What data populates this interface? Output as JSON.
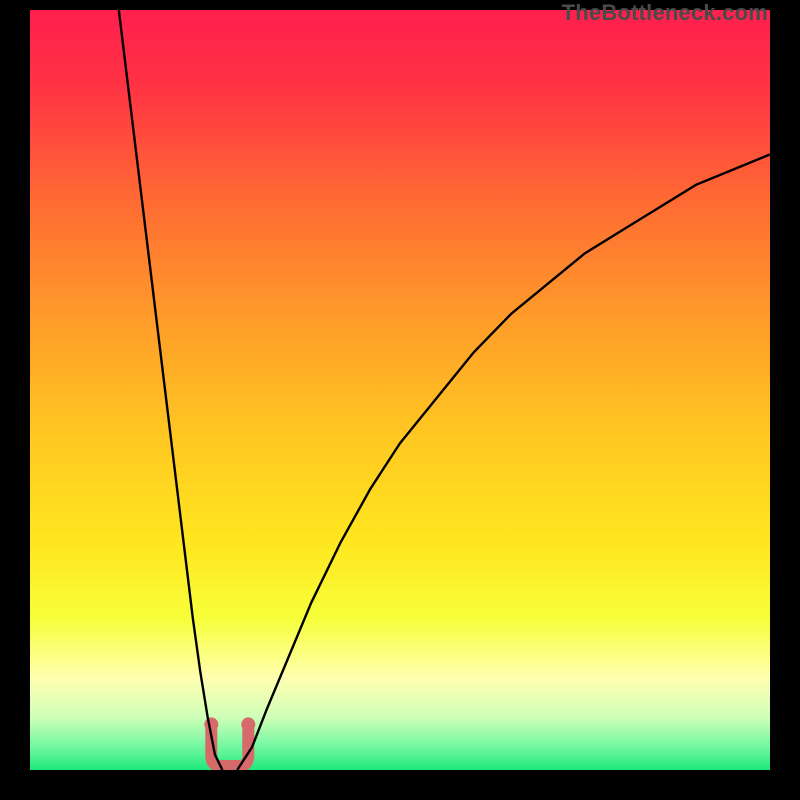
{
  "watermark": "TheBottleneck.com",
  "chart_data": {
    "type": "line",
    "title": "",
    "xlabel": "",
    "ylabel": "",
    "xlim": [
      0,
      100
    ],
    "ylim": [
      0,
      100
    ],
    "grid": false,
    "series": [
      {
        "name": "left-curve",
        "x": [
          12,
          13,
          14,
          15,
          16,
          17,
          18,
          19,
          20,
          21,
          22,
          23,
          24,
          25,
          26
        ],
        "y": [
          100,
          92,
          84,
          76,
          68,
          60,
          52,
          44,
          36,
          28,
          20,
          13,
          7,
          2,
          0
        ]
      },
      {
        "name": "right-curve",
        "x": [
          28,
          30,
          32,
          35,
          38,
          42,
          46,
          50,
          55,
          60,
          65,
          70,
          75,
          80,
          85,
          90,
          95,
          100
        ],
        "y": [
          0,
          3,
          8,
          15,
          22,
          30,
          37,
          43,
          49,
          55,
          60,
          64,
          68,
          71,
          74,
          77,
          79,
          81
        ]
      }
    ],
    "valley_marker": {
      "x_range": [
        24.5,
        29.5
      ],
      "y_range": [
        0,
        6
      ],
      "color": "#d66a6a"
    },
    "background_gradient": {
      "stops": [
        {
          "offset": 0.0,
          "color": "#ff1f4d"
        },
        {
          "offset": 0.1,
          "color": "#ff3344"
        },
        {
          "offset": 0.25,
          "color": "#ff6a33"
        },
        {
          "offset": 0.4,
          "color": "#ff9a2a"
        },
        {
          "offset": 0.55,
          "color": "#ffc522"
        },
        {
          "offset": 0.7,
          "color": "#ffe61f"
        },
        {
          "offset": 0.8,
          "color": "#f7ff3a"
        },
        {
          "offset": 0.88,
          "color": "#ffffb0"
        },
        {
          "offset": 0.93,
          "color": "#d0ffb8"
        },
        {
          "offset": 0.97,
          "color": "#70f7a0"
        },
        {
          "offset": 1.0,
          "color": "#1fe87a"
        }
      ]
    }
  }
}
